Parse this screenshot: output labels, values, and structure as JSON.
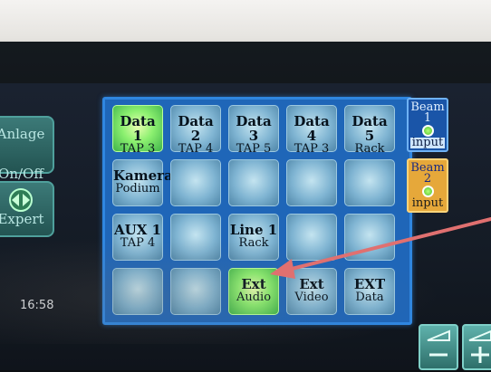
{
  "clock": "16:58",
  "side": {
    "anlage": {
      "line1": "Anlage",
      "line2": "On/Off"
    },
    "expert": "Expert"
  },
  "grid": [
    [
      {
        "l1": "Data 1",
        "l2": "TAP 3",
        "active": true
      },
      {
        "l1": "Data 2",
        "l2": "TAP 4"
      },
      {
        "l1": "Data 3",
        "l2": "TAP 5"
      },
      {
        "l1": "Data 4",
        "l2": "TAP 3"
      },
      {
        "l1": "Data 5",
        "l2": "Rack"
      }
    ],
    [
      {
        "l1": "Kamera",
        "l2": "Podium"
      },
      {
        "l1": "",
        "l2": ""
      },
      {
        "l1": "",
        "l2": ""
      },
      {
        "l1": "",
        "l2": ""
      },
      {
        "l1": "",
        "l2": ""
      }
    ],
    [
      {
        "l1": "AUX 1",
        "l2": "TAP 4"
      },
      {
        "l1": "",
        "l2": ""
      },
      {
        "l1": "Line 1",
        "l2": "Rack"
      },
      {
        "l1": "",
        "l2": ""
      },
      {
        "l1": "",
        "l2": ""
      }
    ],
    [
      {
        "l1": "",
        "l2": ""
      },
      {
        "l1": "",
        "l2": ""
      },
      {
        "l1": "Ext",
        "l2": "Audio",
        "active": true
      },
      {
        "l1": "Ext",
        "l2": "Video"
      },
      {
        "l1": "EXT",
        "l2": "Data"
      }
    ]
  ],
  "beams": [
    {
      "title": "Beam",
      "num": "1",
      "label": "input",
      "color": "#1a55a8"
    },
    {
      "title": "Beam",
      "num": "2",
      "label": "input",
      "color": "#e6a83a"
    }
  ],
  "colors": {
    "active": "#8cf070",
    "panel": "#1f66b8",
    "annotation_arrow": "#e07070"
  }
}
